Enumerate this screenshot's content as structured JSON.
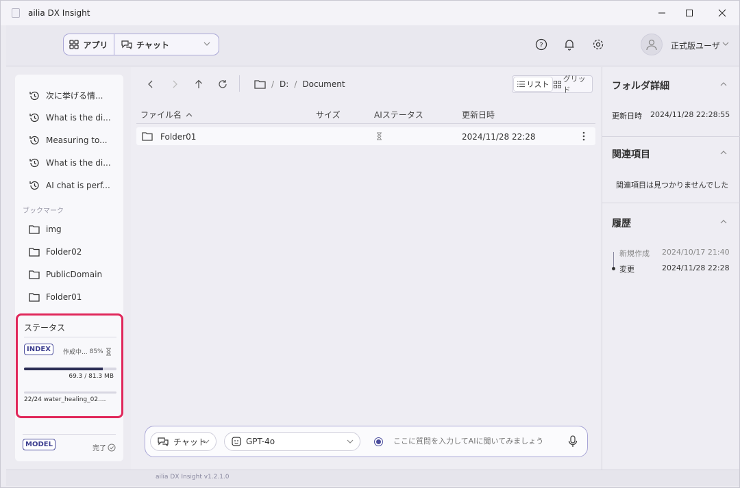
{
  "window": {
    "title": "ailia DX Insight"
  },
  "header": {
    "mode_app_label": "アプリ",
    "mode_chat_label": "チャット",
    "user_name": "正式版ユーザ"
  },
  "sidebar": {
    "history": [
      {
        "label": "次に挙げる情..."
      },
      {
        "label": "What is the di..."
      },
      {
        "label": "Measuring to..."
      },
      {
        "label": "What is the di..."
      },
      {
        "label": "AI chat is perf..."
      }
    ],
    "bookmarks_label": "ブックマーク",
    "bookmarks": [
      {
        "label": "img"
      },
      {
        "label": "Folder02"
      },
      {
        "label": "PublicDomain"
      },
      {
        "label": "Folder01"
      }
    ],
    "status": {
      "title": "ステータス",
      "index_badge": "INDEX",
      "index_state": "作成中...",
      "index_percent": "85%",
      "progress": 0.85,
      "size_text": "69.3 / 81.3 MB",
      "file_progress": "22/24   water_healing_02...."
    },
    "model": {
      "badge": "MODEL",
      "state": "完了"
    }
  },
  "main": {
    "path": {
      "drive": "D:",
      "sep1": "/",
      "sep2": "/",
      "folder": "Document"
    },
    "view_toggle": {
      "list": "リスト",
      "grid": "グリッド"
    },
    "columns": {
      "name": "ファイル名",
      "size": "サイズ",
      "ai_status": "AIステータス",
      "updated": "更新日時"
    },
    "rows": [
      {
        "name": "Folder01",
        "size": "",
        "updated": "2024/11/28 22:28"
      }
    ],
    "chat": {
      "mode_label": "チャット",
      "model_label": "GPT-4o",
      "placeholder": "ここに質問を入力してAIに聞いてみましょう"
    }
  },
  "details": {
    "folder_section": "フォルダ詳細",
    "updated_label": "更新日時",
    "updated_value": "2024/11/28 22:28:55",
    "related_section": "関連項目",
    "related_empty": "関連項目は見つかりませんでした",
    "history_section": "履歴",
    "history": [
      {
        "action": "新規作成",
        "date": "2024/10/17 21:40"
      },
      {
        "action": "変更",
        "date": "2024/11/28 22:28"
      }
    ]
  },
  "footer": {
    "version": "ailia DX Insight v1.2.1.0"
  },
  "colors": {
    "accent": "#4a4c9c",
    "highlight_border": "#e0275a",
    "progress": "#2b2d55"
  }
}
